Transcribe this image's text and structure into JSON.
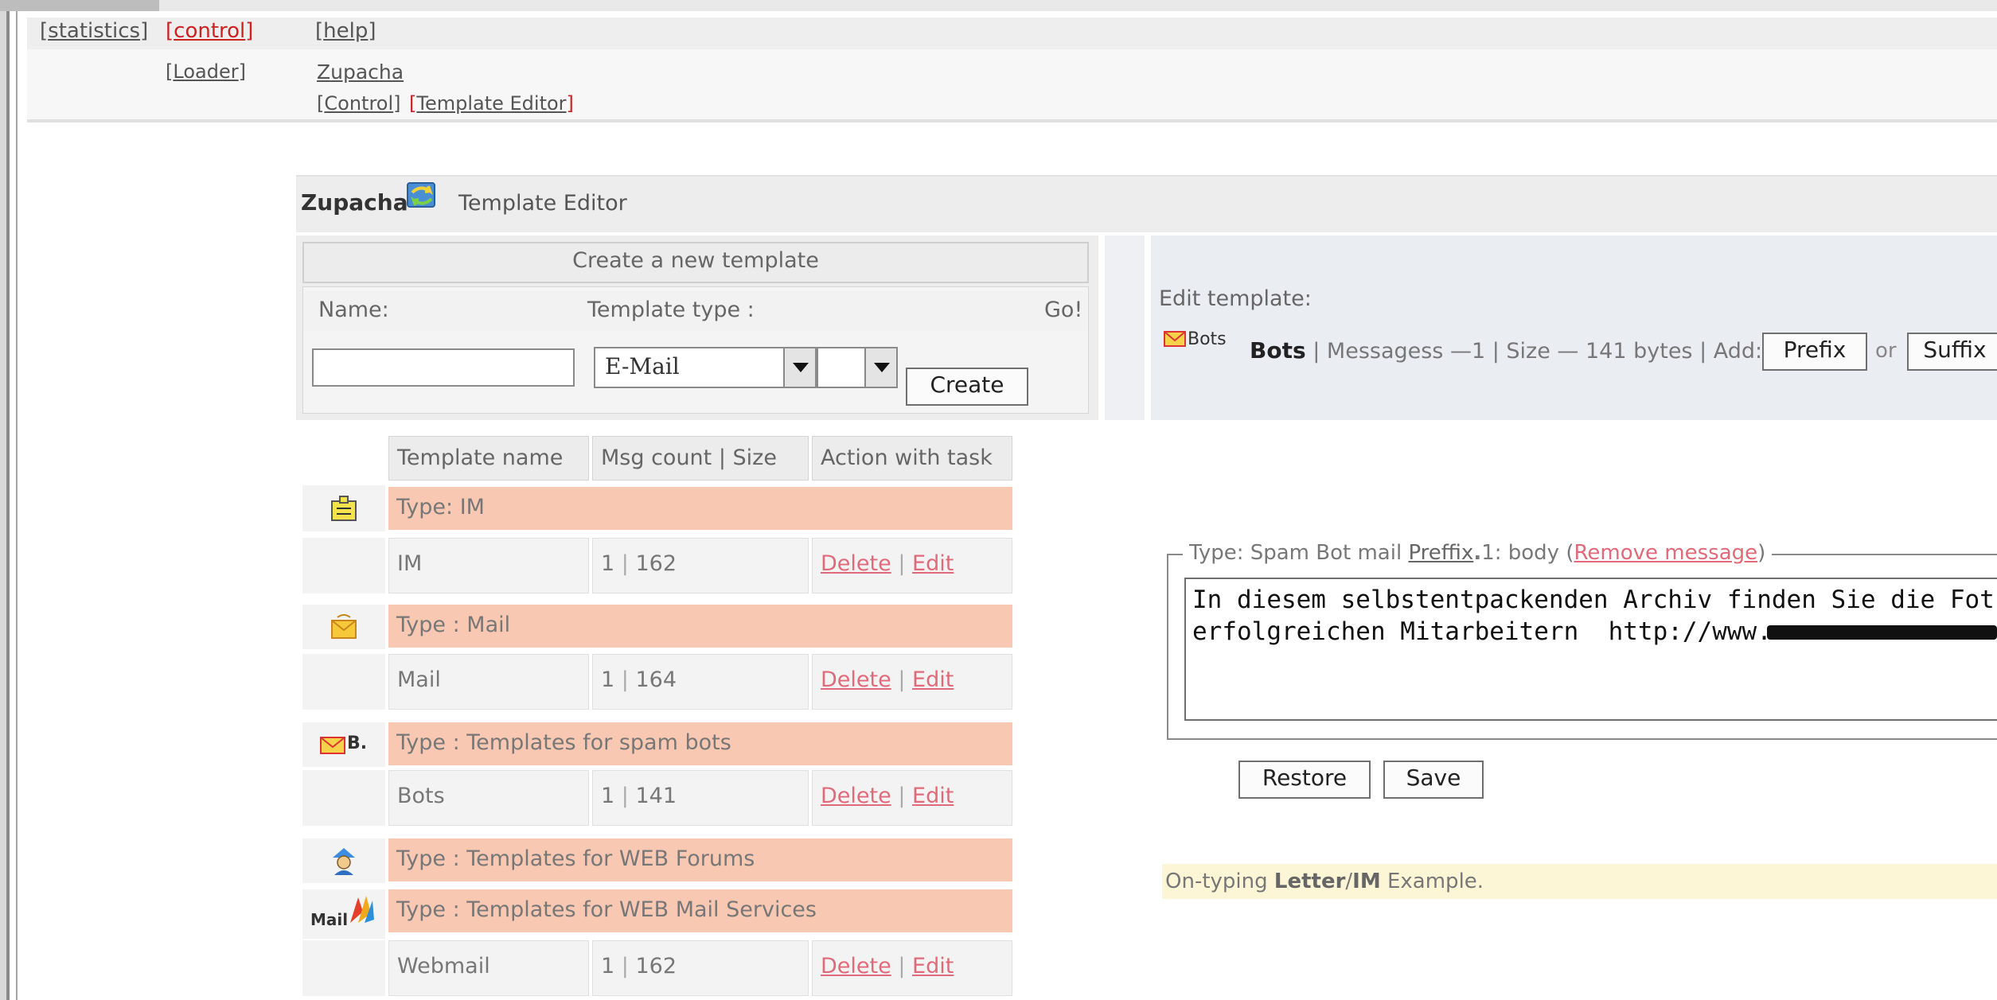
{
  "nav": {
    "statistics": "statistics",
    "control": "control",
    "help": "help",
    "loader": "Loader",
    "zupacha": "Zupacha",
    "sub_control": "Control",
    "template_editor": "Template Editor"
  },
  "header": {
    "app_name": "Zupacha",
    "title": "Template Editor",
    "icon": "refresh-arrows-icon"
  },
  "create_panel": {
    "title": "Create a new template",
    "name_label": "Name:",
    "type_label": "Template type :",
    "go_label": "Go!",
    "name_value": "",
    "type_selected": "E-Mail",
    "sub_type_selected": "",
    "create_button": "Create"
  },
  "edit_panel": {
    "label": "Edit template:",
    "mini_icon_text": "Bots",
    "template_name": "Bots",
    "messages_text": "Messagess —1",
    "size_text": "Size — 141 bytes",
    "add_label": "Add:",
    "prefix_button": "Prefix",
    "or_text": "or",
    "suffix_button": "Suffix"
  },
  "table": {
    "headers": [
      "Template name",
      "Msg count | Size",
      "Action with task"
    ],
    "groups": [
      {
        "type_label": "Type: IM",
        "icon": "im-contact-icon",
        "rows": [
          {
            "name": "IM",
            "count": "1",
            "size": "162"
          }
        ]
      },
      {
        "type_label": "Type : Mail",
        "icon": "mail-envelope-icon",
        "rows": [
          {
            "name": "Mail",
            "count": "1",
            "size": "164"
          }
        ]
      },
      {
        "type_label": "Type : Templates for spam bots",
        "icon": "spam-bot-mail-icon",
        "icon_text": "B.",
        "rows": [
          {
            "name": "Bots",
            "count": "1",
            "size": "141"
          }
        ]
      },
      {
        "type_label": "Type : Templates for WEB Forums",
        "icon": "forum-user-icon",
        "rows": []
      },
      {
        "type_label": "Type : Templates for WEB Mail Services",
        "icon": "webmail-logo-icon",
        "icon_text": "Mail",
        "rows": [
          {
            "name": "Webmail",
            "count": "1",
            "size": "162"
          }
        ]
      }
    ],
    "delete_label": "Delete",
    "edit_label": "Edit"
  },
  "message": {
    "legend_prefix": "Type: Spam Bot mail",
    "legend_link": "Preffix",
    "legend_suffix": "1: body",
    "remove_link": "Remove message",
    "line1": "In diesem selbstentpackenden Archiv finden Sie die Fot",
    "line2": "erfolgreichen Mitarbeitern  http://www."
  },
  "buttons": {
    "restore": "Restore",
    "save": "Save"
  },
  "ontyping": {
    "prefix": "On-typing",
    "letter": "Letter",
    "im": "IM",
    "suffix": "Example."
  },
  "colors": {
    "type_row": "#f8c8b2",
    "link": "#e06a7a",
    "active_nav": "#cc2222",
    "hint_bg": "#fdf6d6"
  }
}
